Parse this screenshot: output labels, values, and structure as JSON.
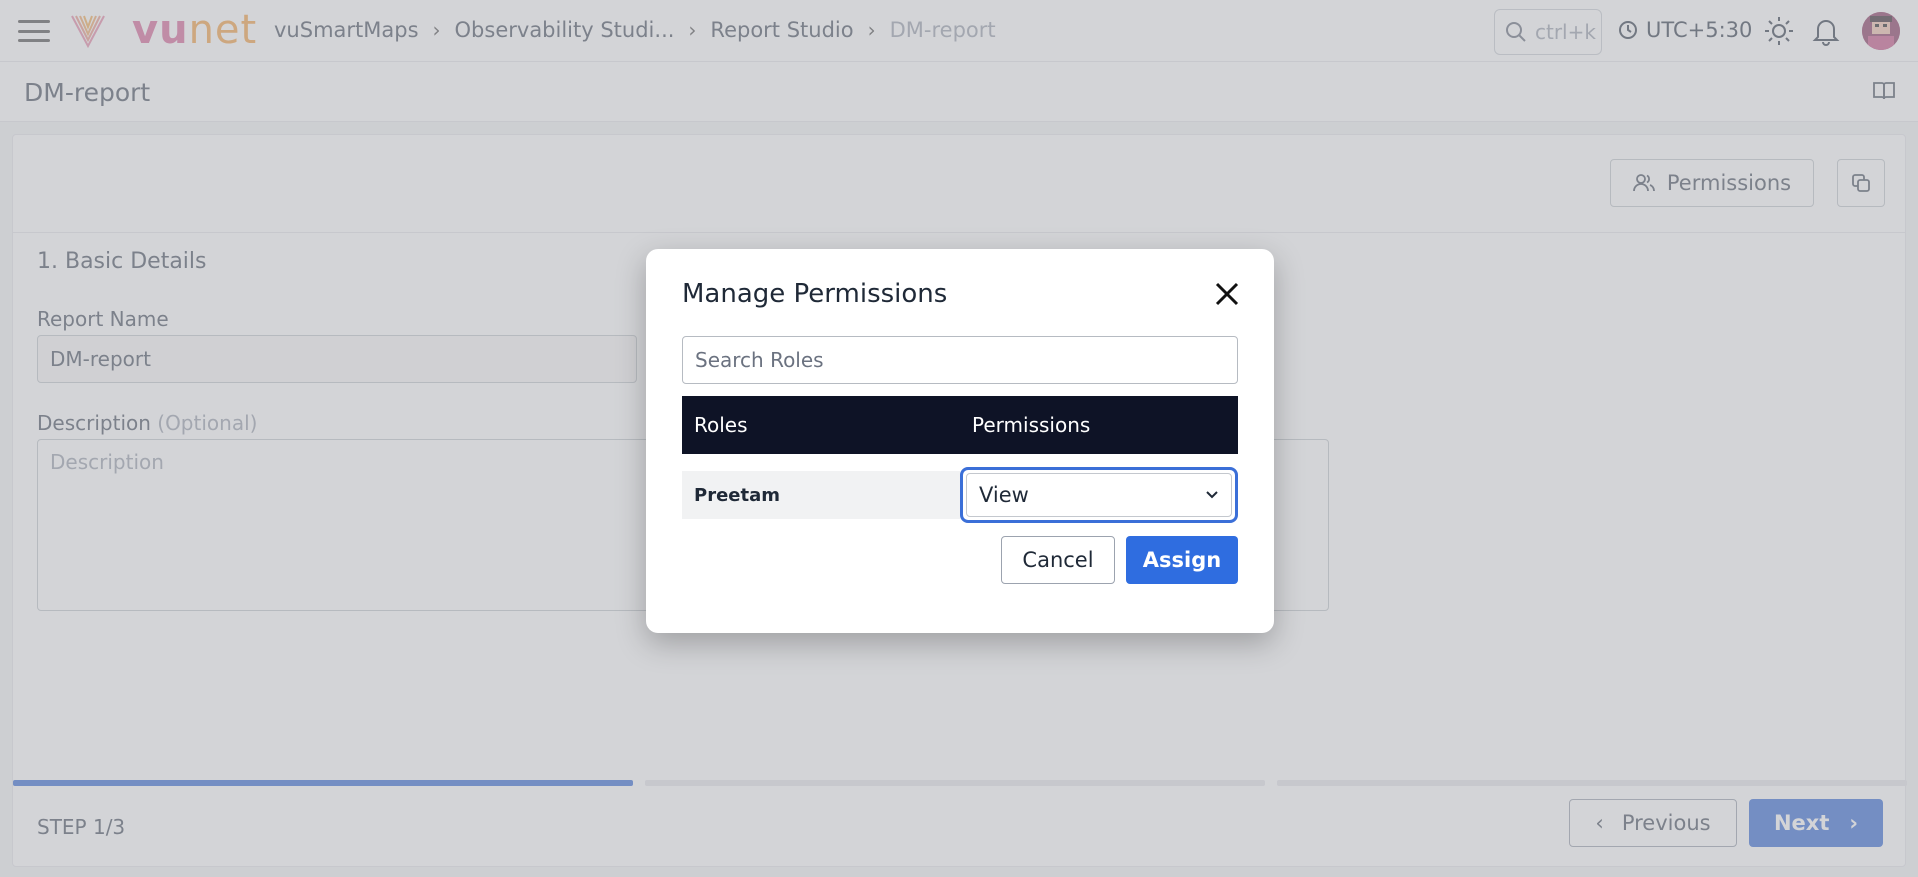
{
  "header": {
    "logo_main": "vu",
    "logo_accent": "net",
    "breadcrumb": [
      "vuSmartMaps",
      "Observability Studi...",
      "Report Studio",
      "DM-report"
    ],
    "search_placeholder": "ctrl+k",
    "timezone": "UTC+5:30"
  },
  "page": {
    "title": "DM-report"
  },
  "toolbar": {
    "permissions_label": "Permissions"
  },
  "form": {
    "section_title": "1. Basic Details",
    "report_name_label": "Report Name",
    "report_name_value": "DM-report",
    "description_label": "Description",
    "description_optional": "(Optional)",
    "description_placeholder": "Description"
  },
  "stepper": {
    "step_label": "STEP 1/3",
    "progress": 0.3333,
    "previous_label": "Previous",
    "next_label": "Next"
  },
  "modal": {
    "title": "Manage Permissions",
    "search_placeholder": "Search Roles",
    "columns": [
      "Roles",
      "Permissions"
    ],
    "rows": [
      {
        "role": "Preetam",
        "permission": "View"
      }
    ],
    "cancel_label": "Cancel",
    "assign_label": "Assign"
  },
  "colors": {
    "accent": "#3b6fd8",
    "table_header": "#0e1326",
    "logo_pink": "#d76a9c",
    "logo_orange": "#f2a24a"
  }
}
